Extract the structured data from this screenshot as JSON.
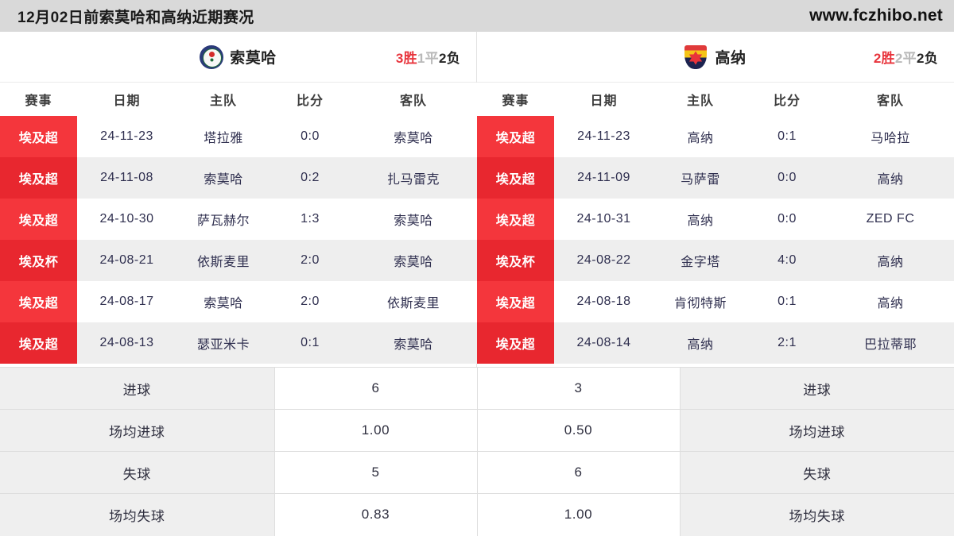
{
  "topbar": {
    "title": "12月02日前索莫哈和高纳近期赛况",
    "site": "www.fczhibo.net"
  },
  "left_panel": {
    "team_name": "索莫哈",
    "logo_icon": "smouha-crest-icon",
    "record": {
      "wins": "3胜",
      "draws": "1平",
      "losses": "2负"
    },
    "columns": [
      "赛事",
      "日期",
      "主队",
      "比分",
      "客队"
    ],
    "rows": [
      {
        "league": "埃及超",
        "date": "24-11-23",
        "home": "塔拉雅",
        "score": "0:0",
        "away": "索莫哈"
      },
      {
        "league": "埃及超",
        "date": "24-11-08",
        "home": "索莫哈",
        "score": "0:2",
        "away": "扎马雷克"
      },
      {
        "league": "埃及超",
        "date": "24-10-30",
        "home": "萨瓦赫尔",
        "score": "1:3",
        "away": "索莫哈"
      },
      {
        "league": "埃及杯",
        "date": "24-08-21",
        "home": "依斯麦里",
        "score": "2:0",
        "away": "索莫哈"
      },
      {
        "league": "埃及超",
        "date": "24-08-17",
        "home": "索莫哈",
        "score": "2:0",
        "away": "依斯麦里"
      },
      {
        "league": "埃及超",
        "date": "24-08-13",
        "home": "瑟亚米卡",
        "score": "0:1",
        "away": "索莫哈"
      }
    ]
  },
  "right_panel": {
    "team_name": "高纳",
    "logo_icon": "ghazl-shield-icon",
    "record": {
      "wins": "2胜",
      "draws": "2平",
      "losses": "2负"
    },
    "columns": [
      "赛事",
      "日期",
      "主队",
      "比分",
      "客队"
    ],
    "rows": [
      {
        "league": "埃及超",
        "date": "24-11-23",
        "home": "高纳",
        "score": "0:1",
        "away": "马哈拉"
      },
      {
        "league": "埃及超",
        "date": "24-11-09",
        "home": "马萨雷",
        "score": "0:0",
        "away": "高纳"
      },
      {
        "league": "埃及超",
        "date": "24-10-31",
        "home": "高纳",
        "score": "0:0",
        "away": "ZED FC"
      },
      {
        "league": "埃及杯",
        "date": "24-08-22",
        "home": "金字塔",
        "score": "4:0",
        "away": "高纳"
      },
      {
        "league": "埃及超",
        "date": "24-08-18",
        "home": "肯彻特斯",
        "score": "0:1",
        "away": "高纳"
      },
      {
        "league": "埃及超",
        "date": "24-08-14",
        "home": "高纳",
        "score": "2:1",
        "away": "巴拉蒂耶"
      }
    ]
  },
  "stats": {
    "rows": [
      {
        "left_label": "进球",
        "left_value": "6",
        "right_value": "3",
        "right_label": "进球"
      },
      {
        "left_label": "场均进球",
        "left_value": "1.00",
        "right_value": "0.50",
        "right_label": "场均进球"
      },
      {
        "left_label": "失球",
        "left_value": "5",
        "right_value": "6",
        "right_label": "失球"
      },
      {
        "left_label": "场均失球",
        "left_value": "0.83",
        "right_value": "1.00",
        "right_label": "场均失球"
      }
    ]
  },
  "colors": {
    "league_badge": "#f4363c",
    "win": "#e8343c",
    "draw": "#b9b9b9",
    "loss": "#262626",
    "topbar_bg": "#d9d9d9",
    "row_alt": "#eeeeee",
    "stat_label_bg": "#efefef"
  }
}
